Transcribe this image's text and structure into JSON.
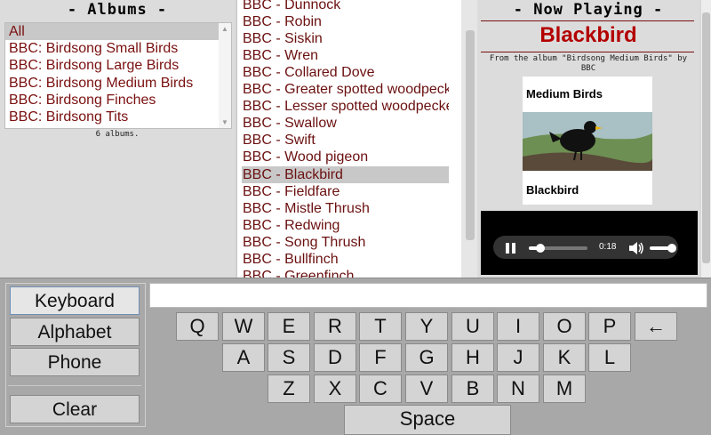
{
  "albums": {
    "header": "- Albums -",
    "items": [
      "All",
      "BBC: Birdsong Small Birds",
      "BBC: Birdsong Large Birds",
      "BBC: Birdsong Medium Birds",
      "BBC: Birdsong Finches",
      "BBC: Birdsong Tits"
    ],
    "selected_index": 0,
    "count_text": "6 albums."
  },
  "tracks": {
    "items": [
      "BBC - Dunnock",
      "BBC - Robin",
      "BBC - Siskin",
      "BBC - Wren",
      "BBC - Collared Dove",
      "BBC - Greater spotted woodpecker",
      "BBC - Lesser spotted woodpecker",
      "BBC - Swallow",
      "BBC - Swift",
      "BBC - Wood pigeon",
      "BBC - Blackbird",
      "BBC - Fieldfare",
      "BBC - Mistle Thrush",
      "BBC - Redwing",
      "BBC - Song Thrush",
      "BBC - Bullfinch",
      "BBC - Greenfinch"
    ],
    "selected_index": 10
  },
  "now_playing": {
    "header": "- Now Playing -",
    "title": "Blackbird",
    "from_line1": "From the album \"Birdsong Medium Birds\" by",
    "from_line2": "BBC",
    "cover_top_text": "Medium Birds",
    "cover_bottom_text": "Blackbird"
  },
  "player": {
    "time": "0:18",
    "progress_fraction": 0.2,
    "volume_fraction": 0.85
  },
  "modes": {
    "keyboard": "Keyboard",
    "alphabet": "Alphabet",
    "phone": "Phone",
    "clear": "Clear"
  },
  "entry": {
    "value": ""
  },
  "keys": {
    "row1": [
      "Q",
      "W",
      "E",
      "R",
      "T",
      "Y",
      "U",
      "I",
      "O",
      "P",
      "←"
    ],
    "row2": [
      "A",
      "S",
      "D",
      "F",
      "G",
      "H",
      "J",
      "K",
      "L"
    ],
    "row3": [
      "Z",
      "X",
      "C",
      "V",
      "B",
      "N",
      "M"
    ],
    "space": "Space"
  },
  "colors": {
    "track_text": "#6b1010",
    "title_red": "#b30000",
    "panel_bg": "#dcdcdc",
    "keyboard_bg": "#a8a8a8"
  }
}
